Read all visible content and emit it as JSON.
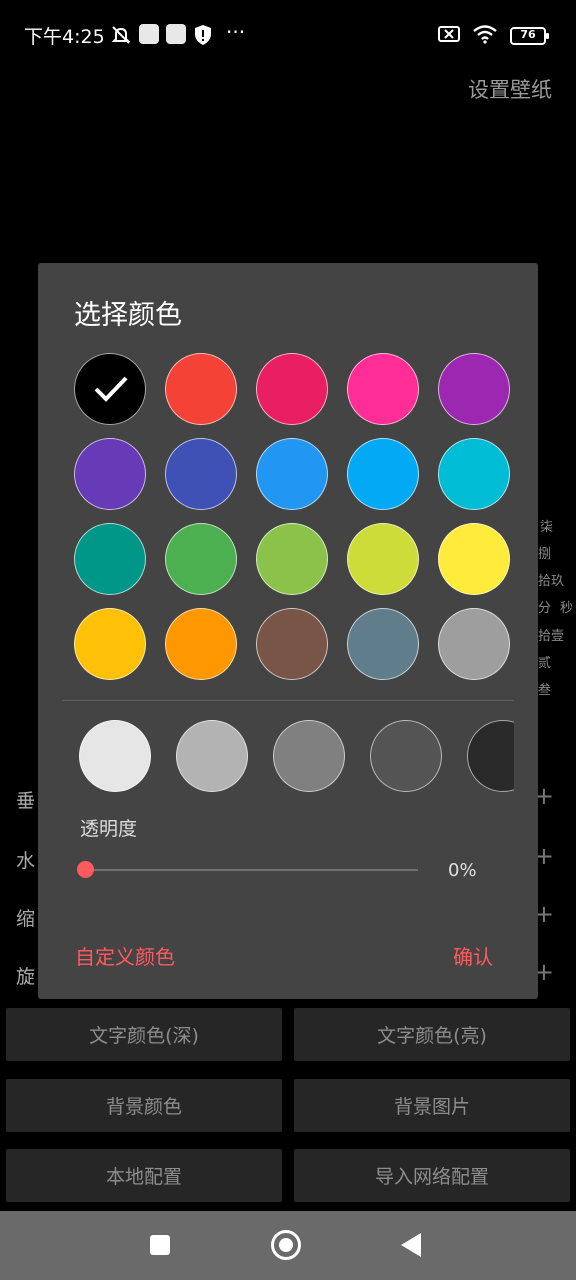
{
  "status_bar": {
    "time": "下午4:25",
    "more": "···",
    "battery": "76"
  },
  "top_action": "设置壁纸",
  "background": {
    "clock_chars": [
      "柒",
      "捌",
      "拾玖",
      "分",
      "秒",
      "拾壹",
      "贰",
      "叁"
    ],
    "rows": [
      {
        "label": "垂",
        "plus": "+"
      },
      {
        "label": "水",
        "plus": "+"
      },
      {
        "label": "缩",
        "plus": "+"
      },
      {
        "label": "旋",
        "plus": "+"
      }
    ],
    "buttons": [
      "文字颜色(深)",
      "文字颜色(亮)",
      "背景颜色",
      "背景图片",
      "本地配置",
      "导入网络配置"
    ]
  },
  "dialog": {
    "title": "选择颜色",
    "palette": [
      "#000000",
      "#f44336",
      "#e91e63",
      "#ff2d95",
      "#9c27b0",
      "#673ab7",
      "#3f51b5",
      "#2196f3",
      "#03a9f4",
      "#00bcd4",
      "#009688",
      "#4caf50",
      "#8bc34a",
      "#cddc39",
      "#ffeb3b",
      "#ffc107",
      "#ff9800",
      "#795548",
      "#607d8b",
      "#9e9e9e"
    ],
    "selected_index": 0,
    "shades": [
      "#e6e6e6",
      "#b3b3b3",
      "#808080",
      "#545454",
      "#2a2a2a"
    ],
    "opacity_label": "透明度",
    "opacity_value": "0%",
    "opacity_fraction": 0,
    "custom_color_label": "自定义颜色",
    "confirm_label": "确认",
    "accent_color": "#ff5a5f"
  }
}
